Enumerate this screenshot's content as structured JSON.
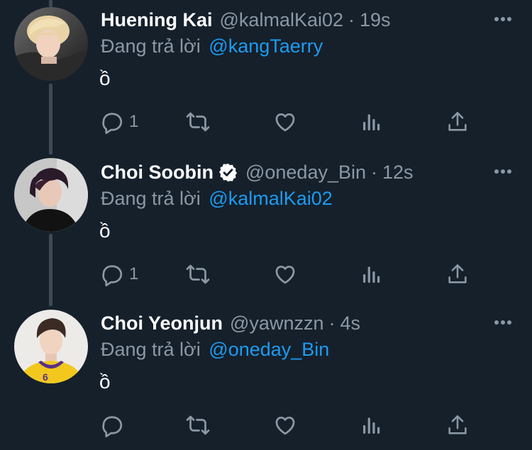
{
  "tweets": [
    {
      "name": "Huening Kai",
      "verified": false,
      "handle": "@kalmalKai02",
      "separator": "·",
      "time": "19s",
      "reply_prefix": "Đang trả lời",
      "reply_to": "@kangTaerry",
      "text": "ồ",
      "reply_count": "1"
    },
    {
      "name": "Choi Soobin",
      "verified": true,
      "handle": "@oneday_Bin",
      "separator": "·",
      "time": "12s",
      "reply_prefix": "Đang trả lời",
      "reply_to": "@kalmalKai02",
      "text": "ồ",
      "reply_count": "1"
    },
    {
      "name": "Choi Yeonjun",
      "verified": false,
      "handle": "@yawnzzn",
      "separator": "·",
      "time": "4s",
      "reply_prefix": "Đang trả lời",
      "reply_to": "@oneday_Bin",
      "text": "ồ",
      "reply_count": ""
    }
  ],
  "icons": {
    "reply": "reply-icon",
    "retweet": "retweet-icon",
    "like": "heart-icon",
    "views": "analytics-icon",
    "share": "share-icon",
    "more": "more-icon",
    "verified": "verified-badge-icon"
  },
  "colors": {
    "background": "#15202b",
    "text": "#ffffff",
    "secondary_text": "#8b98a5",
    "mention": "#1d9bf0",
    "thread_line": "#3d4a56",
    "icon": "#8b98a5"
  }
}
